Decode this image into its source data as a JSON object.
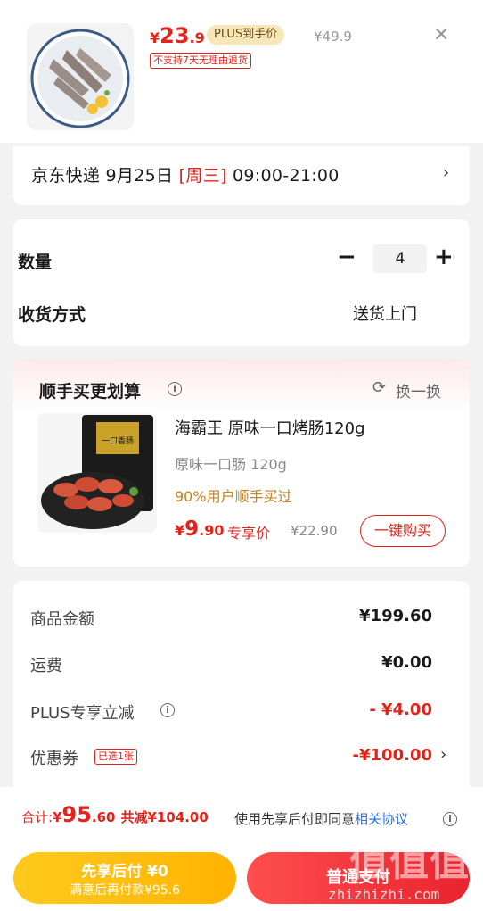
{
  "product": {
    "price_symbol": "¥",
    "price_int": "23",
    "price_dec": ".9",
    "plus_badge": "PLUS到手价",
    "original_price": "¥49.9",
    "return_notice": "不支持7天无理由退货"
  },
  "delivery": {
    "prefix": "京东快递 9月25日 ",
    "weekday": "[周三]",
    "time": " 09:00-21:00"
  },
  "order": {
    "qty_label": "数量",
    "qty_value": "4",
    "shipping_label": "收货方式",
    "shipping_value": "送货上门"
  },
  "addon": {
    "title": "顺手买更划算",
    "refresh_label": "换一换",
    "name": "海霸王 原味一口烤肠120g",
    "spec": "原味一口肠 120g",
    "stat": "90%用户顺手买过",
    "price_symbol": "¥",
    "price_int": "9",
    "price_dec": ".90",
    "price_tag": "专享价",
    "original_price": "¥22.90",
    "buy_label": "一键购买",
    "package_text": "一口香肠"
  },
  "summary": {
    "rows": [
      {
        "label": "商品金额",
        "value": "¥199.60"
      },
      {
        "label": "运费",
        "value": "¥0.00"
      },
      {
        "label": "PLUS专享立减",
        "value": "- ¥4.00"
      },
      {
        "label": "优惠券",
        "value": "-¥100.00"
      }
    ],
    "coupon_tag": "已选1张"
  },
  "checkout": {
    "total_label": "合计: ",
    "total_symbol": "¥",
    "total_int": "95",
    "total_dec": ".60",
    "saved_text": "共减¥104.00",
    "agree_text": "使用先享后付即同意",
    "agree_link": "相关协议",
    "pay_later_title": "先享后付 ¥0",
    "pay_later_sub": "满意后再付款¥95.6",
    "normal_pay": "普通支付"
  },
  "watermark": {
    "cn": "值值值",
    "url": "zhizhizhi.com"
  },
  "colors": {
    "accent_red": "#e2231a",
    "plus_gold": "#f7e7b8",
    "pay_later_yellow": "#ffc91b",
    "link_blue": "#2a6fdb"
  }
}
